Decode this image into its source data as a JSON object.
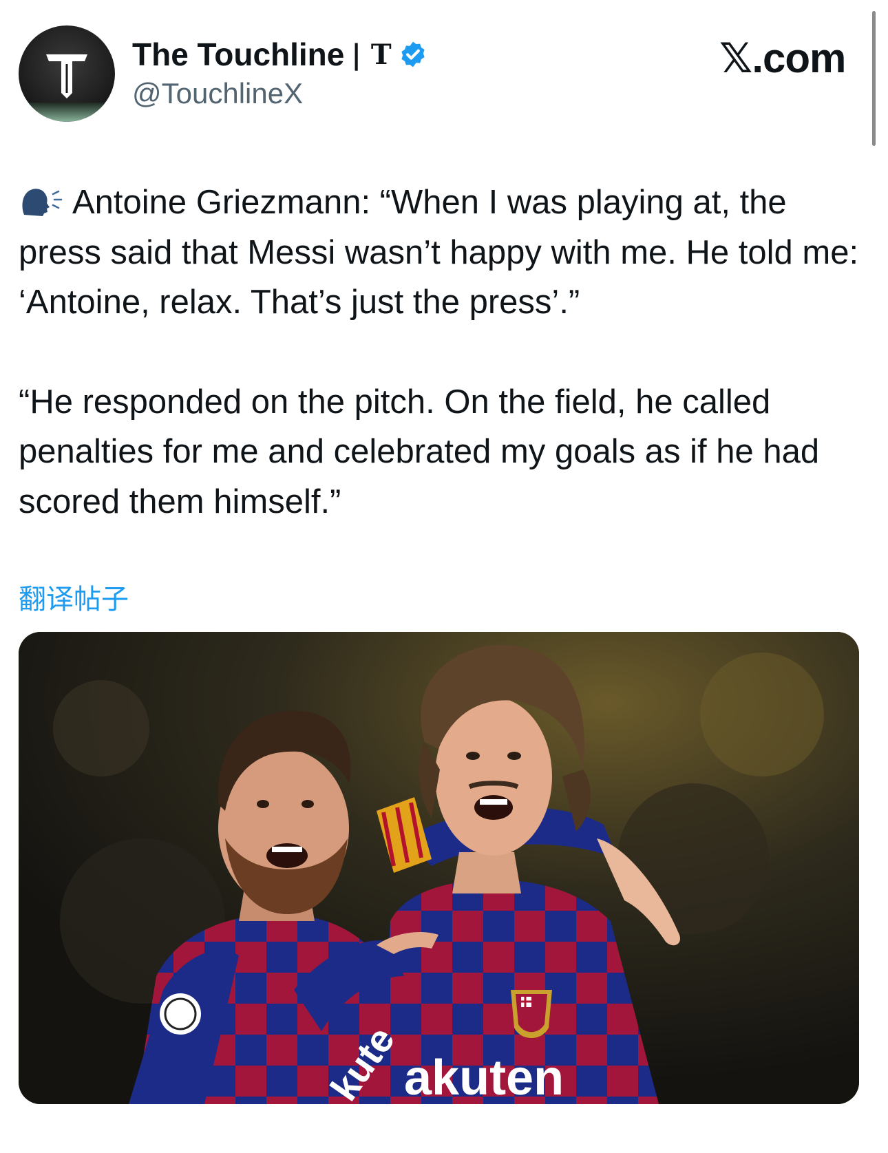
{
  "author": {
    "name": "The Touchline",
    "name_suffix": "| T",
    "handle": "@TouchlineX",
    "avatar_letter": "T",
    "verified": true
  },
  "brand": {
    "label": "𝕏.com"
  },
  "tweet": {
    "paragraph1": "Antoine Griezmann: “When I was playing at, the press said that Messi wasn’t happy with me. He told me: ‘Antoine, relax. That’s just the press’.”",
    "paragraph2": "“He responded on the pitch. On the field, he called penalties for me and celebrated my goals as if he had scored them himself.”",
    "leading_icon": "speaking-head-icon"
  },
  "translate_label": "翻译帖子",
  "media": {
    "jersey_text": "akuten",
    "jersey_text_left": "kute"
  },
  "colors": {
    "accent": "#1d9bf0",
    "text": "#0f1419",
    "secondary": "#536471"
  }
}
